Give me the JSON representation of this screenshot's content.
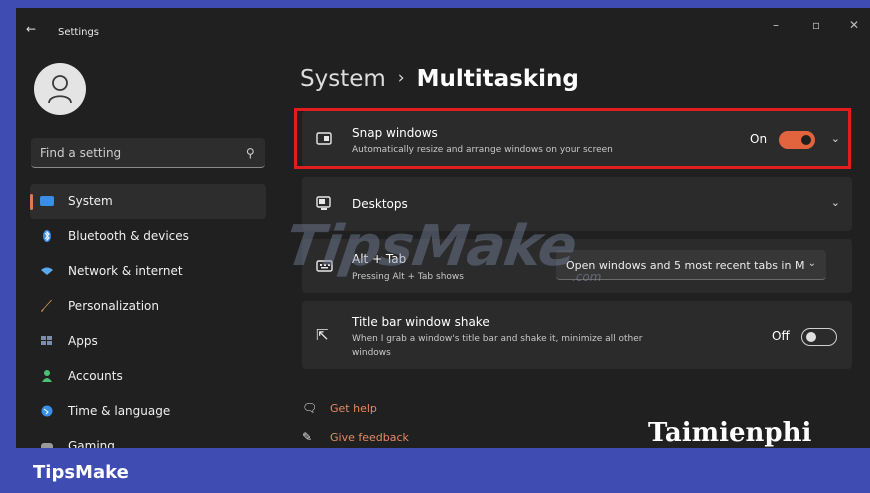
{
  "window": {
    "title": "Settings",
    "back_icon": "back-arrow-icon",
    "controls": {
      "minimize": "–",
      "maximize": "▫",
      "close": "✕"
    }
  },
  "sidebar": {
    "search_placeholder": "Find a setting",
    "items": [
      {
        "label": "System",
        "icon": "system-icon",
        "color": "#3a8ee6",
        "active": true
      },
      {
        "label": "Bluetooth & devices",
        "icon": "bluetooth-icon",
        "color": "#3a8ee6"
      },
      {
        "label": "Network & internet",
        "icon": "network-icon",
        "color": "#5aa9f0"
      },
      {
        "label": "Personalization",
        "icon": "brush-icon",
        "color": "#e8a55a"
      },
      {
        "label": "Apps",
        "icon": "apps-icon",
        "color": "#7d8ca8"
      },
      {
        "label": "Accounts",
        "icon": "accounts-icon",
        "color": "#4bbf73"
      },
      {
        "label": "Time & language",
        "icon": "time-language-icon",
        "color": "#3a8ee6"
      },
      {
        "label": "Gaming",
        "icon": "gaming-icon",
        "color": "#9a9a9a"
      }
    ]
  },
  "breadcrumb": {
    "parent": "System",
    "separator": "›",
    "current": "Multitasking"
  },
  "cards": {
    "snap": {
      "title": "Snap windows",
      "subtitle": "Automatically resize and arrange windows on your screen",
      "state": "On"
    },
    "desktops": {
      "title": "Desktops"
    },
    "alttab": {
      "title": "Alt + Tab",
      "subtitle": "Pressing Alt + Tab shows",
      "dropdown_value": "Open windows and 5 most recent tabs in M"
    },
    "shake": {
      "title": "Title bar window shake",
      "subtitle": "When I grab a window's title bar and shake it, minimize all other windows",
      "state": "Off"
    }
  },
  "links": {
    "help": "Get help",
    "feedback": "Give feedback"
  },
  "watermarks": {
    "main": "TipsMake",
    "com": ".com",
    "brand": "Taimienphi"
  },
  "footer": {
    "label": "TipsMake"
  },
  "colors": {
    "accent": "#e2643e",
    "highlight": "#e11d1d",
    "frame": "#3f4db3",
    "link": "#e58a64"
  }
}
